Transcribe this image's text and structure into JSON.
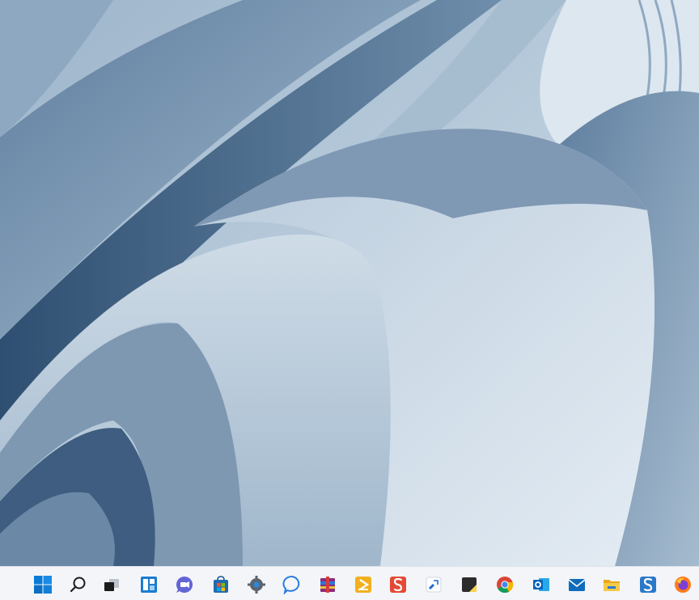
{
  "desktop": {
    "wallpaper": "windows-11-bloom-blue-wallpaper"
  },
  "taskbar": {
    "background": "#f3f5f8",
    "items": [
      {
        "name": "start-button",
        "icon": "windows-logo-icon"
      },
      {
        "name": "search-button",
        "icon": "search-icon"
      },
      {
        "name": "task-view-button",
        "icon": "task-view-icon"
      },
      {
        "name": "widgets-button",
        "icon": "widgets-icon"
      },
      {
        "name": "teams-chat-button",
        "icon": "teams-chat-icon"
      },
      {
        "name": "microsoft-store-button",
        "icon": "store-icon"
      },
      {
        "name": "settings-button",
        "icon": "gear-icon"
      },
      {
        "name": "messenger-button",
        "icon": "messenger-icon"
      },
      {
        "name": "winrar-button",
        "icon": "winrar-icon"
      },
      {
        "name": "powerautomate-button",
        "icon": "power-automate-icon"
      },
      {
        "name": "snagit-button",
        "icon": "snagit-icon"
      },
      {
        "name": "snipping-tool-button",
        "icon": "snipping-tool-icon"
      },
      {
        "name": "sticky-notes-button",
        "icon": "sticky-notes-icon"
      },
      {
        "name": "chrome-button",
        "icon": "chrome-icon"
      },
      {
        "name": "outlook-button",
        "icon": "outlook-icon"
      },
      {
        "name": "mail-button",
        "icon": "mail-icon"
      },
      {
        "name": "file-explorer-button",
        "icon": "folder-icon"
      },
      {
        "name": "snagit-editor-button",
        "icon": "snagit-editor-icon"
      },
      {
        "name": "firefox-button",
        "icon": "firefox-icon"
      }
    ]
  }
}
